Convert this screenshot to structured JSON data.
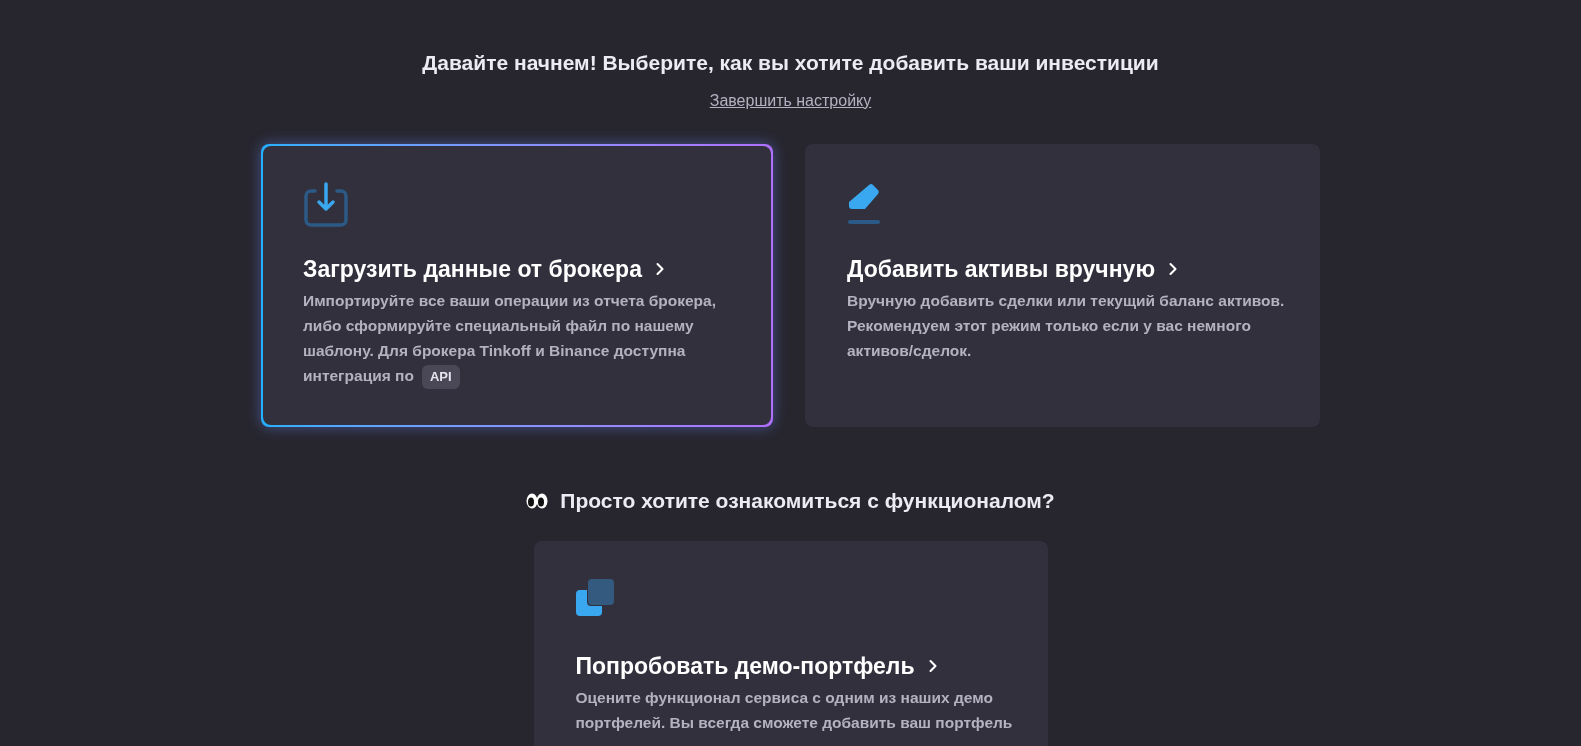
{
  "header": {
    "title": "Давайте начнем! Выберите, как вы хотите добавить ваши инвестиции",
    "skip_link": "Завершить настройку"
  },
  "options": [
    {
      "kind": "import",
      "selected": true,
      "title": "Загрузить данные от брокера",
      "description": "Импортируйте все ваши операции из отчета брокера, либо сформируйте специальный файл по нашему шаблону. Для брокера Tinkoff и Binance доступна интеграция по",
      "badge": "API"
    },
    {
      "kind": "manual",
      "selected": false,
      "title": "Добавить активы вручную",
      "description": "Вручную добавить сделки или текущий баланс активов. Рекомендуем этот режим только если у вас немного активов/сделок."
    }
  ],
  "demo": {
    "heading": "Просто хотите ознакомиться с функционалом?",
    "card": {
      "kind": "demo",
      "selected": false,
      "title": "Попробовать демо-портфель",
      "description": "Оцените функционал сервиса с одним из наших демо портфелей. Вы всегда сможете добавить ваш портфель"
    }
  }
}
